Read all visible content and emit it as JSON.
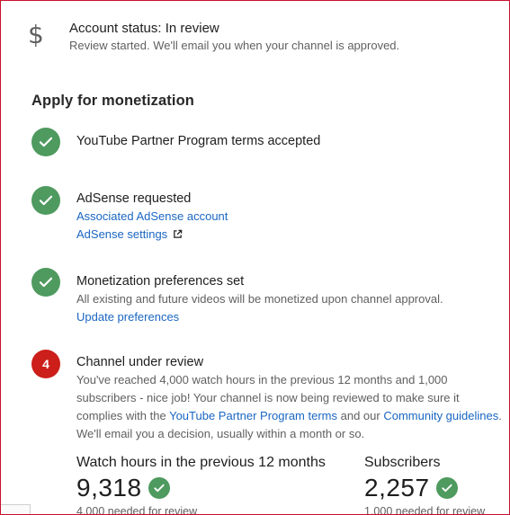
{
  "account_status": {
    "icon": "dollar-icon",
    "title": "Account status: In review",
    "subtitle": "Review started. We'll email you when your channel is approved."
  },
  "section_title": "Apply for monetization",
  "steps": [
    {
      "state": "done",
      "title": "YouTube Partner Program terms accepted"
    },
    {
      "state": "done",
      "title": "AdSense requested",
      "link_1": "Associated AdSense account",
      "link_2": "AdSense settings"
    },
    {
      "state": "done",
      "title": "Monetization preferences set",
      "text": "All existing and future videos will be monetized upon channel approval.",
      "link_1": "Update preferences"
    },
    {
      "state": "pending",
      "number": "4",
      "title": "Channel under review",
      "text_1": "You've reached 4,000 watch hours in the previous 12 months and 1,000 subscribers - nice job! Your channel is now being reviewed to make sure it complies with the ",
      "link_terms": "YouTube Partner Program terms",
      "text_2": " and our ",
      "link_guidelines": "Community guidelines",
      "text_3": ". We'll email you a decision, usually within a month or so."
    }
  ],
  "stats": {
    "watch_hours": {
      "label": "Watch hours in the previous 12 months",
      "value": "9,318",
      "needed": "4,000 needed for review"
    },
    "subscribers": {
      "label": "Subscribers",
      "value": "2,257",
      "needed": "1,000 needed for review"
    }
  },
  "colors": {
    "check_green": "#4e9a5f",
    "pending_red": "#cc1f1a",
    "link_blue": "#1a66c2",
    "frame_border": "#c8102e"
  }
}
